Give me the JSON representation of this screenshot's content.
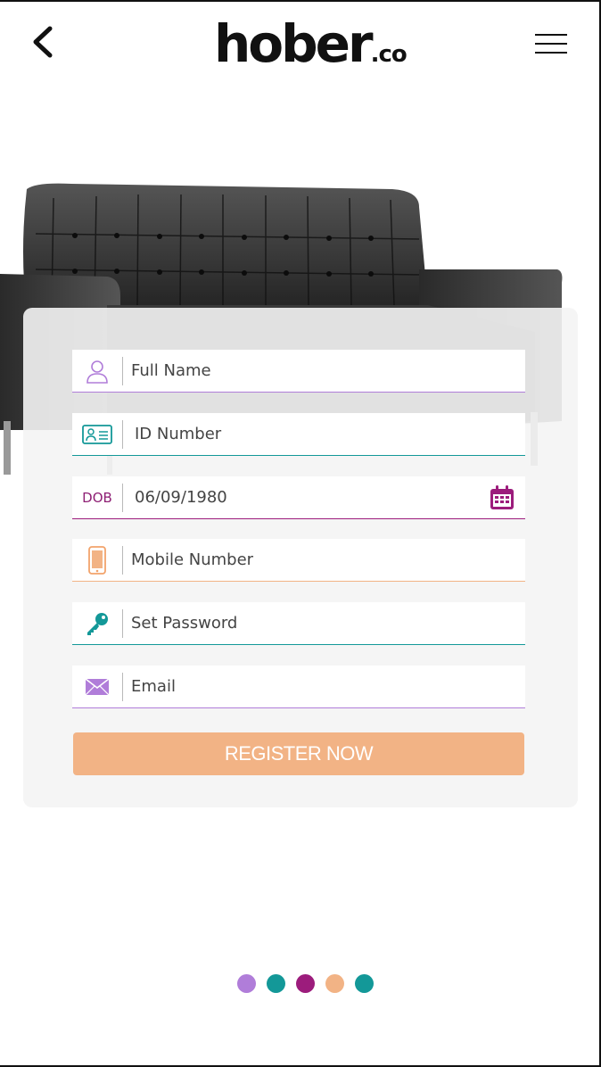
{
  "header": {
    "logo_main": "hober",
    "logo_sub": ".co"
  },
  "form": {
    "full_name": {
      "placeholder": "Full Name",
      "value": ""
    },
    "id_number": {
      "placeholder": "ID Number",
      "value": ""
    },
    "dob": {
      "label": "DOB",
      "value": "06/09/1980"
    },
    "mobile": {
      "placeholder": "Mobile Number",
      "value": ""
    },
    "password": {
      "placeholder": "Set Password",
      "value": ""
    },
    "email": {
      "placeholder": "Email",
      "value": ""
    },
    "register_label": "REGISTER NOW"
  },
  "pagination": {
    "count": 5,
    "dot_colors": [
      "#b07dd9",
      "#139898",
      "#9c1c7c",
      "#f2b385",
      "#139898"
    ]
  },
  "colors": {
    "purple": "#b07dd9",
    "teal": "#139898",
    "magenta": "#9c1c7c",
    "peach": "#f2b385"
  },
  "icons": [
    "back-chevron-icon",
    "hamburger-menu-icon",
    "user-icon",
    "id-card-icon",
    "calendar-icon",
    "mobile-phone-icon",
    "key-icon",
    "envelope-icon"
  ]
}
